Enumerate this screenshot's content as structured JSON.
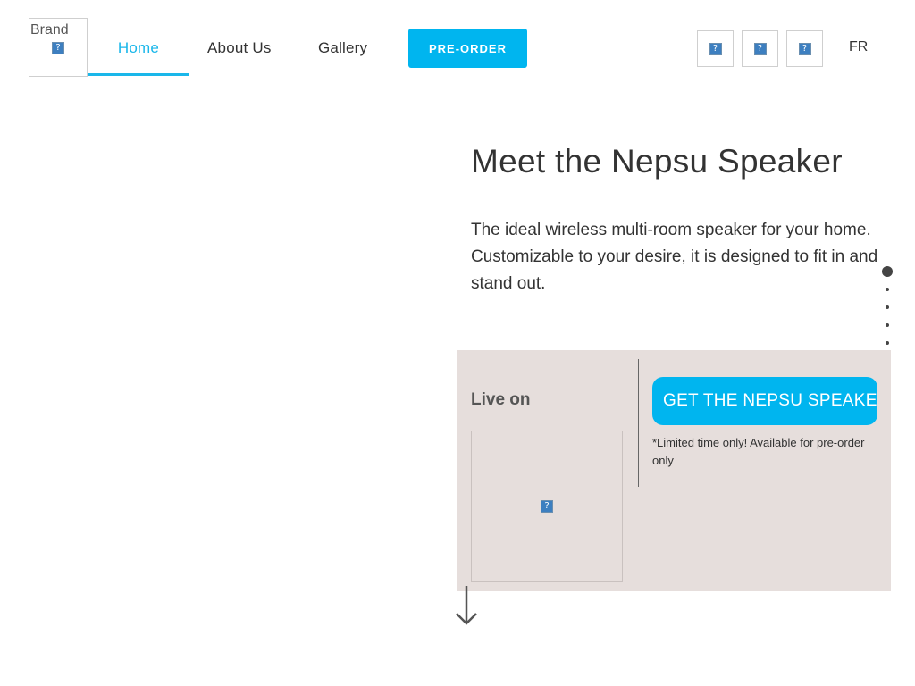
{
  "header": {
    "brand_text": "Brand",
    "brand_image_icon": "broken-image-icon",
    "nav": {
      "home": "Home",
      "about": "About Us",
      "gallery": "Gallery"
    },
    "preorder_label": "PRE-ORDER",
    "social_icons": [
      "broken-image-icon",
      "broken-image-icon",
      "broken-image-icon"
    ],
    "language": "FR"
  },
  "hero": {
    "title": "Meet the Nepsu Speaker",
    "description": "The ideal wireless multi-room speaker for your home. Customizable to your desire, it is designed to fit in and stand out."
  },
  "cta_panel": {
    "live_on": "Live on",
    "cta_label": "GET THE NEPSU SPEAKER",
    "fine_print": "*Limited time only! Available for pre-order only"
  },
  "section_dots": {
    "count": 9,
    "active_index": 0
  },
  "colors": {
    "accent": "#00b5ef",
    "panel_bg": "#e6dedc",
    "text": "#333333"
  },
  "scroll_icon": "arrow-down-icon"
}
